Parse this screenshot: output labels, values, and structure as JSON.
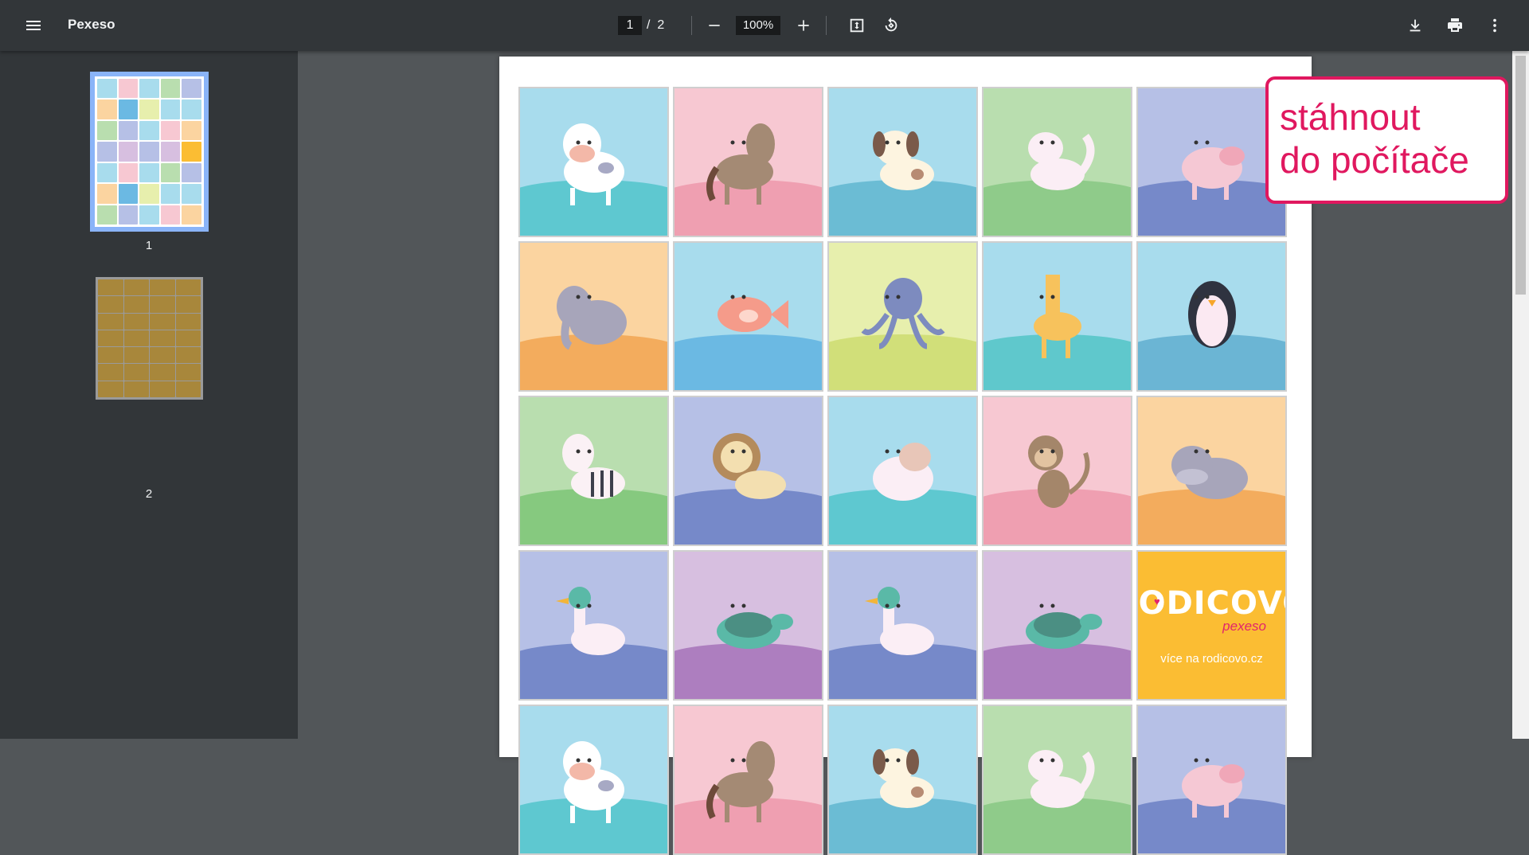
{
  "toolbar": {
    "title": "Pexeso",
    "page_current": "1",
    "page_separator": "/",
    "page_total": "2",
    "zoom": "100%",
    "icons": {
      "menu": "menu-icon",
      "zoom_out": "minus-icon",
      "zoom_in": "plus-icon",
      "fit": "fit-page-icon",
      "rotate": "rotate-icon",
      "download": "download-icon",
      "print": "print-icon",
      "more": "more-vert-icon"
    }
  },
  "sidebar": {
    "thumbnails": [
      {
        "label": "1",
        "selected": true
      },
      {
        "label": "2",
        "selected": false
      }
    ]
  },
  "callout": {
    "line1": "stáhnout",
    "line2": "do počítače",
    "color": "#e0185f"
  },
  "document": {
    "cards": [
      {
        "animal": "cow",
        "bg": "#a8dced",
        "ground": "#5ec8d0"
      },
      {
        "animal": "horse",
        "bg": "#f7c8d2",
        "ground": "#ef9fb1"
      },
      {
        "animal": "dog",
        "bg": "#a8dced",
        "ground": "#6bbcd4"
      },
      {
        "animal": "cat",
        "bg": "#b9deaf",
        "ground": "#8fcb8a"
      },
      {
        "animal": "pig",
        "bg": "#b6c0e6",
        "ground": "#7689c9"
      },
      {
        "animal": "elephant",
        "bg": "#fbd4a0",
        "ground": "#f3ac5d"
      },
      {
        "animal": "fish",
        "bg": "#a8dced",
        "ground": "#6bb9e3"
      },
      {
        "animal": "octopus",
        "bg": "#e7efad",
        "ground": "#d1df79"
      },
      {
        "animal": "giraffe",
        "bg": "#a8dced",
        "ground": "#5fc8cc"
      },
      {
        "animal": "penguin",
        "bg": "#a8dced",
        "ground": "#6bb5d4"
      },
      {
        "animal": "zebra",
        "bg": "#b9deaf",
        "ground": "#86c97f"
      },
      {
        "animal": "lion",
        "bg": "#b6c0e6",
        "ground": "#7689c9"
      },
      {
        "animal": "sheep",
        "bg": "#a8dced",
        "ground": "#5ec8d0"
      },
      {
        "animal": "monkey",
        "bg": "#f7c8d2",
        "ground": "#ef9fb1"
      },
      {
        "animal": "hippo",
        "bg": "#fbd4a0",
        "ground": "#f3ac5d"
      },
      {
        "animal": "duck",
        "bg": "#b6c0e6",
        "ground": "#7689c9"
      },
      {
        "animal": "turtle",
        "bg": "#d7bfe0",
        "ground": "#ad7ebf"
      },
      {
        "animal": "duck",
        "bg": "#b6c0e6",
        "ground": "#7689c9"
      },
      {
        "animal": "turtle",
        "bg": "#d7bfe0",
        "ground": "#ad7ebf"
      },
      {
        "animal": "rodicovo",
        "bg": "#fbbd33",
        "ground": "#fbbd33"
      },
      {
        "animal": "cow",
        "bg": "#a8dced",
        "ground": "#5ec8d0"
      },
      {
        "animal": "horse",
        "bg": "#f7c8d2",
        "ground": "#ef9fb1"
      },
      {
        "animal": "dog",
        "bg": "#a8dced",
        "ground": "#6bbcd4"
      },
      {
        "animal": "cat",
        "bg": "#b9deaf",
        "ground": "#8fcb8a"
      },
      {
        "animal": "pig",
        "bg": "#b6c0e6",
        "ground": "#7689c9"
      }
    ],
    "brand_card": {
      "title": "RODICOVO",
      "subtitle": "pexeso",
      "website": "více na rodicovo.cz"
    }
  }
}
